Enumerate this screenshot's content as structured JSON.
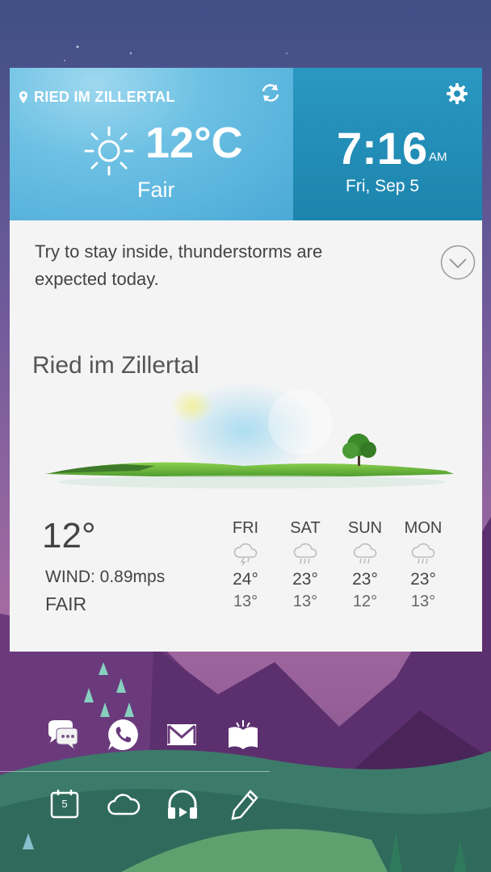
{
  "header": {
    "location": "RIED IM ZILLERTAL",
    "temperature": "12°C",
    "condition": "Fair",
    "time": "7:16",
    "ampm": "AM",
    "date": "Fri, Sep 5"
  },
  "alert": {
    "message": "Try to stay inside, thunderstorms are expected today."
  },
  "detail": {
    "city": "Ried im Zillertal",
    "current_temp": "12°",
    "wind": "WIND: 0.89mps",
    "condition": "FAIR"
  },
  "forecast": [
    {
      "day": "FRI",
      "high": "24°",
      "low": "13°",
      "icon": "thunderstorm-icon"
    },
    {
      "day": "SAT",
      "high": "23°",
      "low": "13°",
      "icon": "rain-icon"
    },
    {
      "day": "SUN",
      "high": "23°",
      "low": "12°",
      "icon": "rain-icon"
    },
    {
      "day": "MON",
      "high": "23°",
      "low": "13°",
      "icon": "rain-icon"
    }
  ],
  "home": {
    "calendar_day": "5"
  },
  "colors": {
    "weather_panel": "#6cc0e3",
    "clock_panel": "#2290ba",
    "card_bg": "#f4f4f4"
  }
}
